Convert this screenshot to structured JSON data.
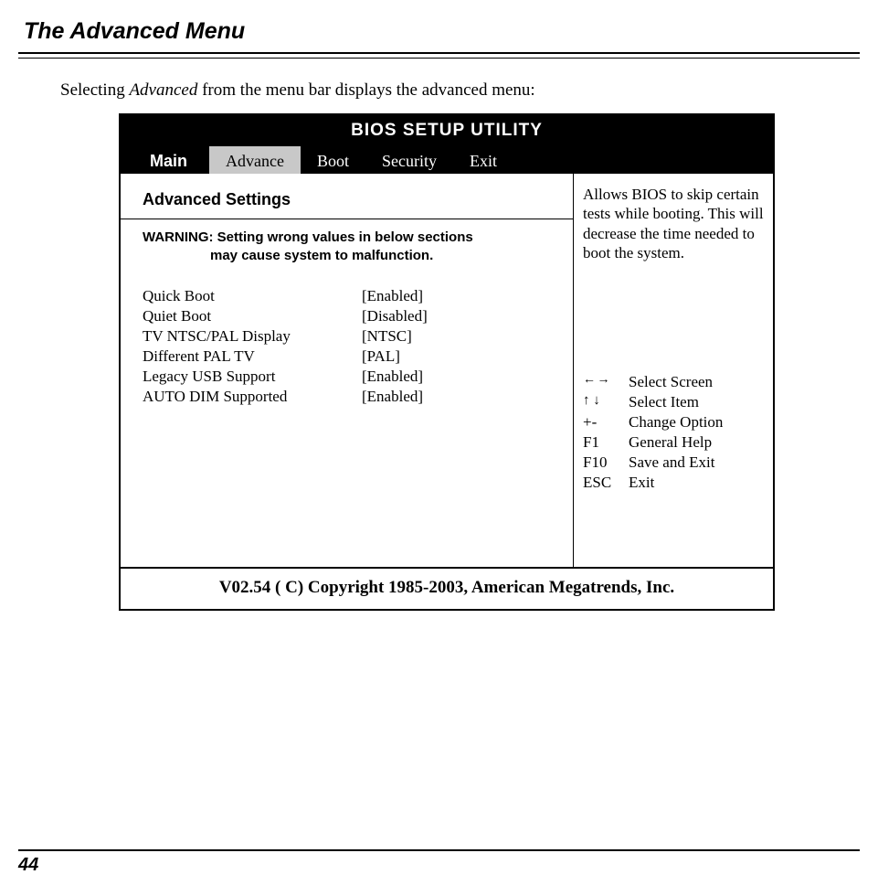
{
  "doc": {
    "section_title": "The Advanced Menu",
    "intro_pre": "Selecting ",
    "intro_em": "Advanced",
    "intro_post": " from the menu bar displays the advanced menu:",
    "page_number": "44"
  },
  "bios": {
    "title": "BIOS SETUP UTILITY",
    "tabs": {
      "main": "Main",
      "advance": "Advance",
      "boot": "Boot",
      "security": "Security",
      "exit": "Exit"
    },
    "heading": "Advanced Settings",
    "warning_l1": "WARNING: Setting wrong values in below sections",
    "warning_l2": "may cause system to malfunction.",
    "settings": [
      {
        "label": "Quick Boot",
        "value": "[Enabled]"
      },
      {
        "label": "Quiet Boot",
        "value": "[Disabled]"
      },
      {
        "label": "TV NTSC/PAL Display",
        "value": "[NTSC]"
      },
      {
        "label": "Different PAL TV",
        "value": "[PAL]"
      },
      {
        "label": "Legacy USB Support",
        "value": "[Enabled]"
      },
      {
        "label": "AUTO DIM Supported",
        "value": "[Enabled]"
      }
    ],
    "help_text": "Allows BIOS to skip certain tests while booting.  This will decrease the time needed to boot the system.",
    "keys": [
      {
        "sym": "← →",
        "desc": "Select Screen"
      },
      {
        "sym": "↑ ↓",
        "desc": "Select Item"
      },
      {
        "sym": "+-",
        "desc": "Change Option"
      },
      {
        "sym": "F1",
        "desc": "General Help"
      },
      {
        "sym": "F10",
        "desc": "Save and Exit"
      },
      {
        "sym": "ESC",
        "desc": "Exit"
      }
    ],
    "footer": "V02.54 ( C) Copyright 1985-2003, American Megatrends, Inc."
  }
}
